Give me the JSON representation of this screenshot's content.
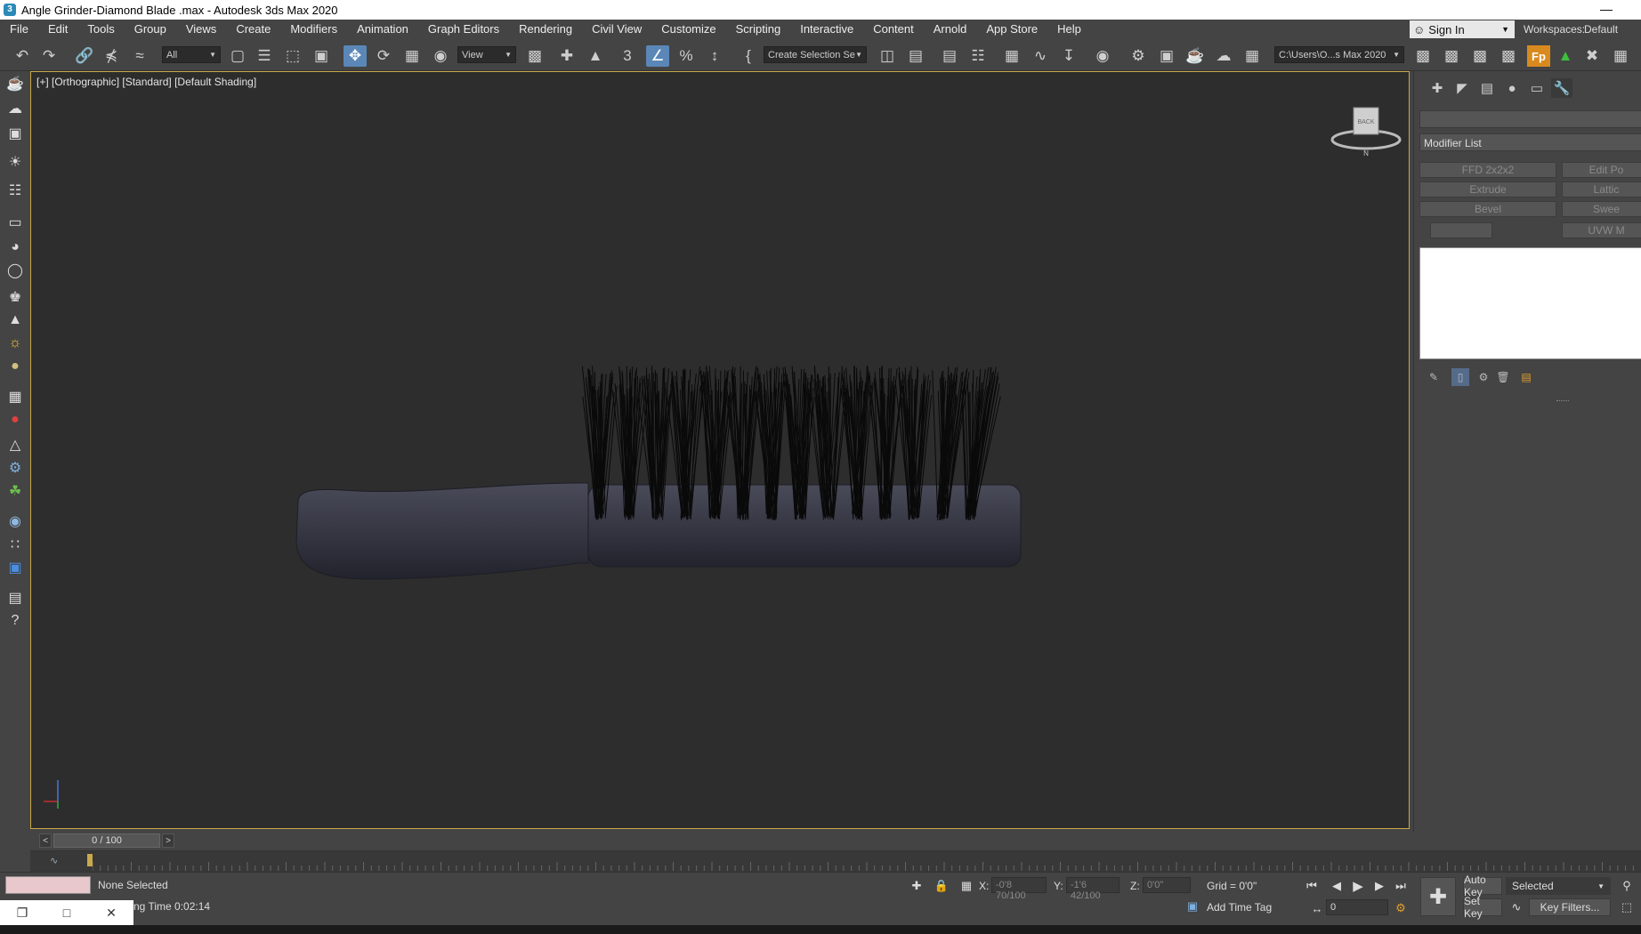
{
  "window": {
    "title": "Angle Grinder-Diamond Blade .max - Autodesk 3ds Max 2020",
    "minimize_glyph": "—"
  },
  "menu": [
    "File",
    "Edit",
    "Tools",
    "Group",
    "Views",
    "Create",
    "Modifiers",
    "Animation",
    "Graph Editors",
    "Rendering",
    "Civil View",
    "Customize",
    "Scripting",
    "Interactive",
    "Content",
    "Arnold",
    "App Store",
    "Help"
  ],
  "account": {
    "sign_in": "Sign In",
    "workspaces_label": "Workspaces:",
    "workspace": "Default"
  },
  "toolbar": {
    "selection_filter": "All",
    "ref_coord": "View",
    "named_selection": "Create Selection Se",
    "project_path": "C:\\Users\\O...s Max 2020"
  },
  "viewport": {
    "label": "[+] [Orthographic] [Standard] [Default Shading]",
    "viewcube_face": "BACK",
    "compass_n": "N"
  },
  "command_panel": {
    "modifier_list": "Modifier List",
    "modifier_buttons": [
      "FFD 2x2x2",
      "Edit Po",
      "Extrude",
      "Lattic",
      "Bevel",
      "Swee",
      "",
      "UVW M"
    ]
  },
  "timeline": {
    "frame": "0 / 100",
    "prev": "<",
    "next": ">"
  },
  "status": {
    "selection": "None Selected",
    "render_time": "ng Time  0:02:14",
    "x_label": "X:",
    "x_value": "-0'8 70/100",
    "y_label": "Y:",
    "y_value": "-1'6 42/100",
    "z_label": "Z:",
    "z_value": "0'0\"",
    "grid": "Grid = 0'0\"",
    "add_time_tag": "Add Time Tag",
    "auto_key": "Auto Key",
    "set_key": "Set Key",
    "key_mode": "Selected",
    "key_filters": "Key Filters...",
    "current_frame": "0"
  },
  "colors": {
    "accent": "#5b87b8",
    "viewport_border": "#c9a94b",
    "viewport_bg": "#2d2d2d"
  }
}
